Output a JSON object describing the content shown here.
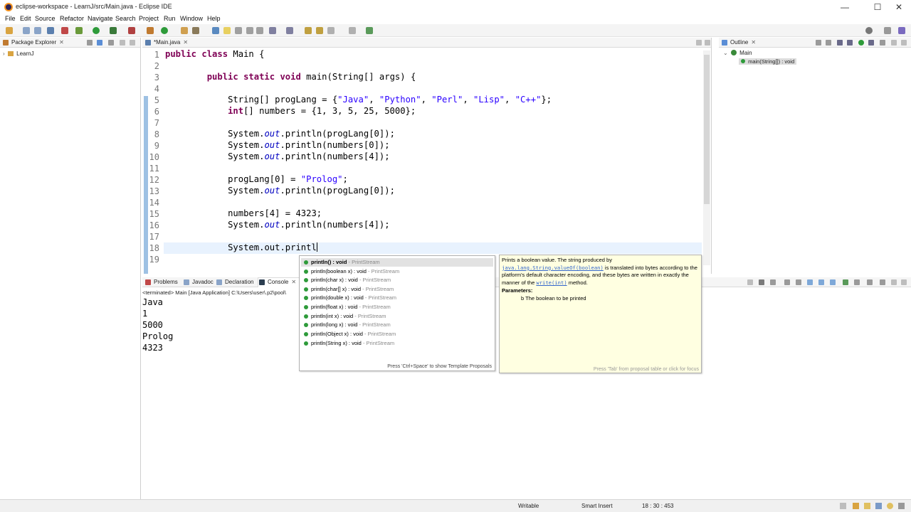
{
  "window": {
    "title": "eclipse-workspace - LearnJ/src/Main.java - Eclipse IDE",
    "minimize": "—",
    "maximize": "☐",
    "close": "✕"
  },
  "menu": [
    "File",
    "Edit",
    "Source",
    "Refactor",
    "Navigate",
    "Search",
    "Project",
    "Run",
    "Window",
    "Help"
  ],
  "package_explorer": {
    "tab_label": "Package Explorer",
    "project": "LearnJ"
  },
  "editor": {
    "tab_label": "*Main.java",
    "line_numbers": [
      "1",
      "2",
      "3",
      "4",
      "5",
      "6",
      "7",
      "8",
      "9",
      "10",
      "11",
      "12",
      "13",
      "14",
      "15",
      "16",
      "17",
      "18",
      "19"
    ]
  },
  "outline": {
    "tab_label": "Outline",
    "class_name": "Main",
    "method": "main(String[]) : void"
  },
  "console": {
    "tabs": [
      "Problems",
      "Javadoc",
      "Declaration",
      "Console"
    ],
    "status": "<terminated> Main [Java Application] C:\\Users\\user\\.p2\\pool\\",
    "output": [
      "Java",
      "1",
      "5000",
      "Prolog",
      "4323"
    ]
  },
  "proposals": {
    "items": [
      {
        "name": "println() : void",
        "type": " - PrintStream"
      },
      {
        "name": "println(boolean x) : void",
        "type": " - PrintStream"
      },
      {
        "name": "println(char x) : void",
        "type": " - PrintStream"
      },
      {
        "name": "println(char[] x) : void",
        "type": " - PrintStream"
      },
      {
        "name": "println(double x) : void",
        "type": " - PrintStream"
      },
      {
        "name": "println(float x) : void",
        "type": " - PrintStream"
      },
      {
        "name": "println(int x) : void",
        "type": " - PrintStream"
      },
      {
        "name": "println(long x) : void",
        "type": " - PrintStream"
      },
      {
        "name": "println(Object x) : void",
        "type": " - PrintStream"
      },
      {
        "name": "println(String x) : void",
        "type": " - PrintStream"
      }
    ],
    "hint": "Press 'Ctrl+Space' to show Template Proposals"
  },
  "javadoc": {
    "text1": "Prints a boolean value. The string produced by ",
    "link1": "java.lang.String.valueOf(boolean)",
    "text2": " is translated into bytes according to the platform's default character encoding, and these bytes are written in exactly the manner of the ",
    "link2": "write(int)",
    "text3": " method.",
    "params_label": "Parameters:",
    "param_name": "b",
    "param_desc": " The boolean to be printed",
    "hint": "Press 'Tab' from proposal table or click for focus"
  },
  "status_bar": {
    "mode": "Writable",
    "insert": "Smart Insert",
    "position": "18 : 30 : 453"
  },
  "colors": {
    "keyword": "#7f0055",
    "string": "#2a00ff",
    "field": "#0000c0",
    "change_bar": "#9ec1e3"
  }
}
